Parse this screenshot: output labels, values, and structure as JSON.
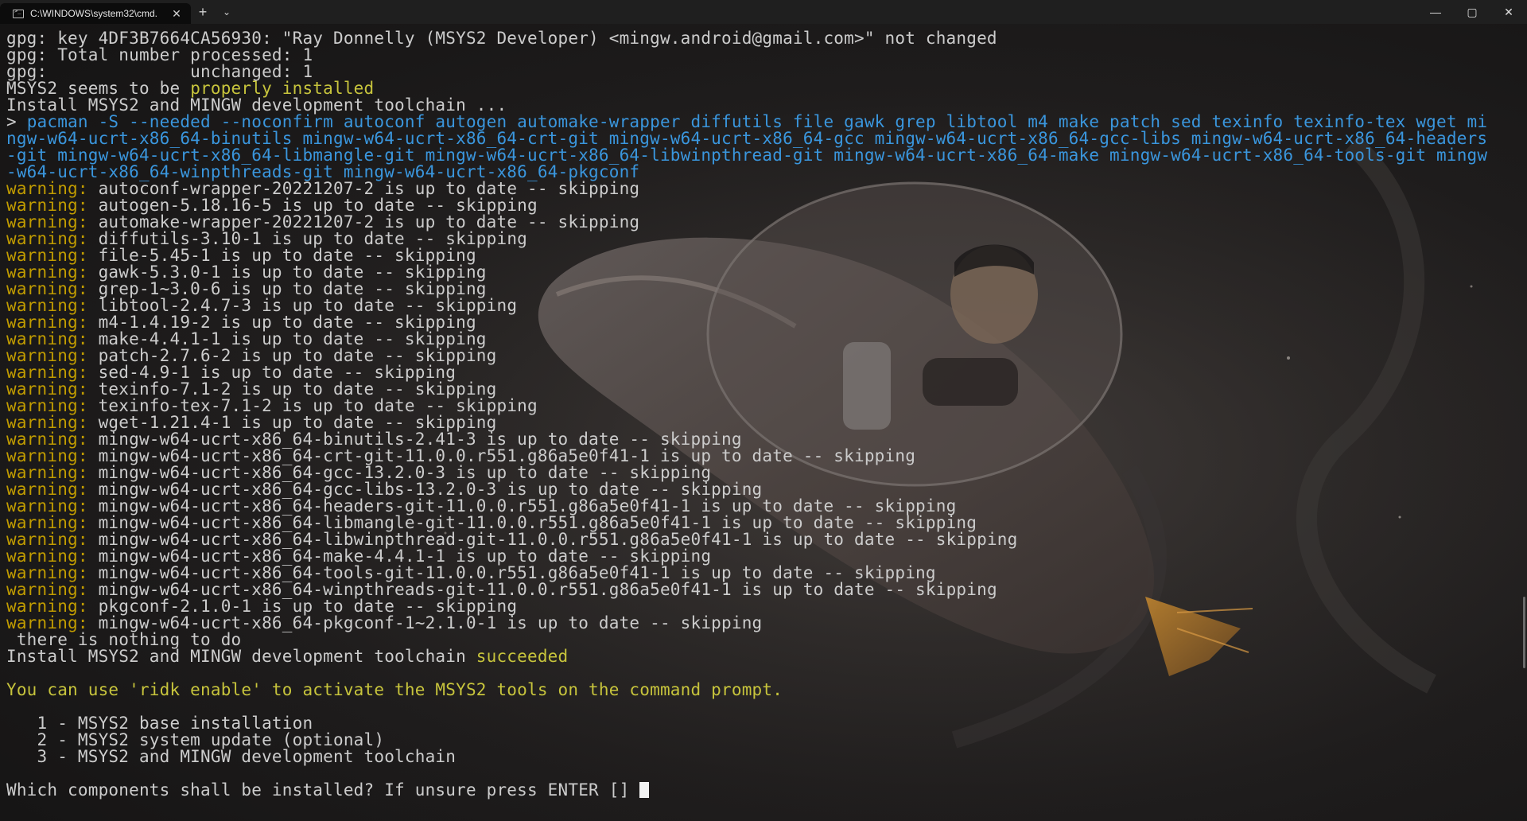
{
  "tab": {
    "title": "C:\\WINDOWS\\system32\\cmd.",
    "close": "✕",
    "new_tab": "+",
    "dropdown": "⌄"
  },
  "window_controls": {
    "minimize": "—",
    "maximize": "▢",
    "close": "✕"
  },
  "colors": {
    "warning": "#c19c00",
    "cyan": "#3a96dd",
    "green": "#7fb33d",
    "text": "#cccccc"
  },
  "terminal": {
    "gpg_key": "gpg: key 4DF3B7664CA56930: \"Ray Donnelly (MSYS2 Developer) <mingw.android@gmail.com>\" not changed",
    "gpg_total": "gpg: Total number processed: 1",
    "gpg_unchanged": "gpg:              unchanged: 1",
    "msys_prefix": "MSYS2 seems to be ",
    "msys_status": "properly installed",
    "install_line": "Install MSYS2 and MINGW development toolchain ...",
    "prompt": "> ",
    "pacman_1": "pacman -S --needed --noconfirm autoconf autogen automake-wrapper diffutils file gawk grep libtool m4 make patch sed texinfo texinfo-tex wget mi",
    "pacman_2": "ngw-w64-ucrt-x86_64-binutils mingw-w64-ucrt-x86_64-crt-git mingw-w64-ucrt-x86_64-gcc mingw-w64-ucrt-x86_64-gcc-libs mingw-w64-ucrt-x86_64-headers",
    "pacman_3": "-git mingw-w64-ucrt-x86_64-libmangle-git mingw-w64-ucrt-x86_64-libwinpthread-git mingw-w64-ucrt-x86_64-make mingw-w64-ucrt-x86_64-tools-git mingw",
    "pacman_4": "-w64-ucrt-x86_64-winpthreads-git mingw-w64-ucrt-x86_64-pkgconf",
    "warning_label": "warning:",
    "warnings": [
      " autoconf-wrapper-20221207-2 is up to date -- skipping",
      " autogen-5.18.16-5 is up to date -- skipping",
      " automake-wrapper-20221207-2 is up to date -- skipping",
      " diffutils-3.10-1 is up to date -- skipping",
      " file-5.45-1 is up to date -- skipping",
      " gawk-5.3.0-1 is up to date -- skipping",
      " grep-1~3.0-6 is up to date -- skipping",
      " libtool-2.4.7-3 is up to date -- skipping",
      " m4-1.4.19-2 is up to date -- skipping",
      " make-4.4.1-1 is up to date -- skipping",
      " patch-2.7.6-2 is up to date -- skipping",
      " sed-4.9-1 is up to date -- skipping",
      " texinfo-7.1-2 is up to date -- skipping",
      " texinfo-tex-7.1-2 is up to date -- skipping",
      " wget-1.21.4-1 is up to date -- skipping",
      " mingw-w64-ucrt-x86_64-binutils-2.41-3 is up to date -- skipping",
      " mingw-w64-ucrt-x86_64-crt-git-11.0.0.r551.g86a5e0f41-1 is up to date -- skipping",
      " mingw-w64-ucrt-x86_64-gcc-13.2.0-3 is up to date -- skipping",
      " mingw-w64-ucrt-x86_64-gcc-libs-13.2.0-3 is up to date -- skipping",
      " mingw-w64-ucrt-x86_64-headers-git-11.0.0.r551.g86a5e0f41-1 is up to date -- skipping",
      " mingw-w64-ucrt-x86_64-libmangle-git-11.0.0.r551.g86a5e0f41-1 is up to date -- skipping",
      " mingw-w64-ucrt-x86_64-libwinpthread-git-11.0.0.r551.g86a5e0f41-1 is up to date -- skipping",
      " mingw-w64-ucrt-x86_64-make-4.4.1-1 is up to date -- skipping",
      " mingw-w64-ucrt-x86_64-tools-git-11.0.0.r551.g86a5e0f41-1 is up to date -- skipping",
      " mingw-w64-ucrt-x86_64-winpthreads-git-11.0.0.r551.g86a5e0f41-1 is up to date -- skipping",
      " pkgconf-2.1.0-1 is up to date -- skipping",
      " mingw-w64-ucrt-x86_64-pkgconf-1~2.1.0-1 is up to date -- skipping"
    ],
    "nothing_to_do": " there is nothing to do",
    "result_prefix": "Install MSYS2 and MINGW development toolchain ",
    "result_status": "succeeded",
    "ridk_hint": "You can use 'ridk enable' to activate the MSYS2 tools on the command prompt.",
    "options": [
      "   1 - MSYS2 base installation",
      "   2 - MSYS2 system update (optional)",
      "   3 - MSYS2 and MINGW development toolchain"
    ],
    "question": "Which components shall be installed? If unsure press ENTER [] "
  }
}
